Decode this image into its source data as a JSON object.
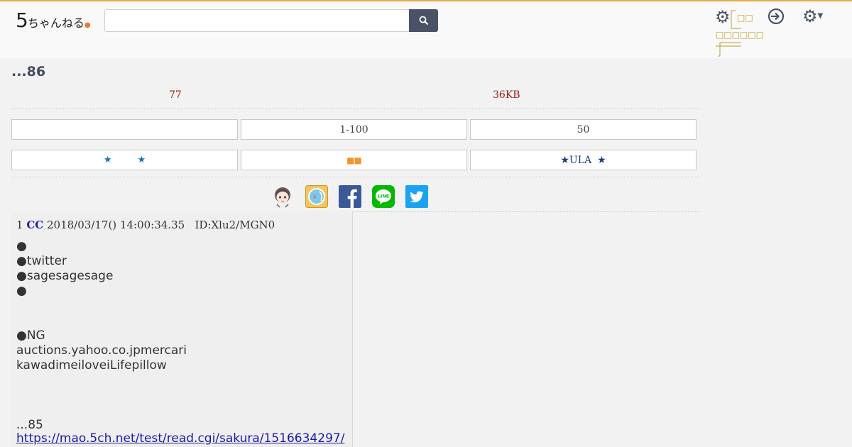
{
  "header": {
    "logo_mark": "5",
    "logo_text": "ちゃんねる",
    "search": {
      "value": "",
      "placeholder": ""
    },
    "gear_label_1": "□□",
    "gear_label_2": "□□□□□□"
  },
  "thread": {
    "title": "...86",
    "post_count": "77",
    "size": "36KB"
  },
  "nav": {
    "row1": [
      "",
      "1-100",
      "50"
    ],
    "row2": {
      "left_star_1": "★",
      "left_star_2": "★",
      "middle": "■■",
      "right_star_1": "★",
      "right_text": "ULA",
      "right_star_2": "★"
    }
  },
  "post": {
    "number": "1",
    "name": "CC",
    "date": "2018/03/17() 14:00:34.35",
    "id": "ID:Xlu2/MGN0",
    "lines": [
      "●",
      "●twitter",
      "●sagesagesage",
      "●",
      "",
      "",
      "●NG",
      "auctions.yahoo.co.jpmercari",
      "kawadimeiloveiLifepillow",
      "",
      "",
      "",
      "...85"
    ],
    "link": "https://mao.5ch.net/test/read.cgi/sakura/1516634297/"
  },
  "colors": {
    "accent_line": "#e8a94a",
    "search_button": "#4a5266",
    "info_red": "#a01818",
    "name_blue": "#1f1fb0",
    "facebook": "#3b5998",
    "line": "#00b900",
    "twitter": "#1da1f2"
  },
  "icons": {
    "search": "search-icon",
    "settings": "gear-icon",
    "login": "login-icon",
    "menu": "gear-dropdown-icon",
    "share": [
      "avatar-icon",
      "app-icon",
      "facebook-icon",
      "line-icon",
      "twitter-icon"
    ]
  }
}
